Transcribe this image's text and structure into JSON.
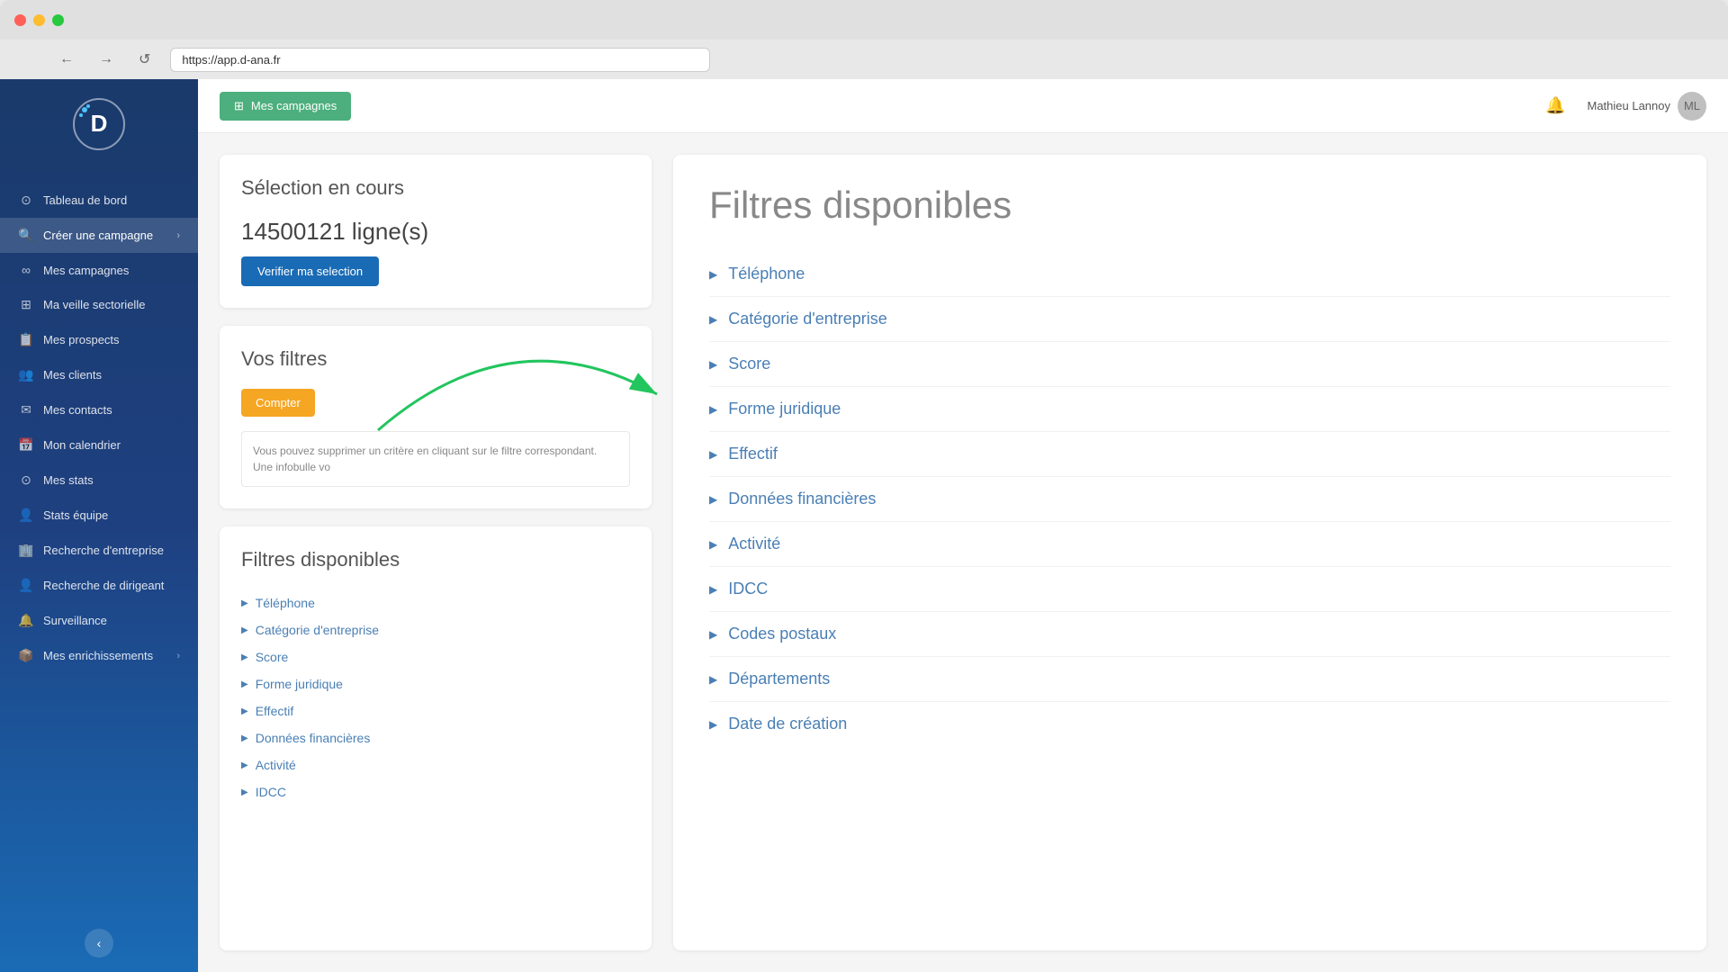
{
  "browser": {
    "url": "https://app.d-ana.fr",
    "traffic_lights": [
      "red",
      "yellow",
      "green"
    ]
  },
  "topbar": {
    "campagnes_label": "Mes campagnes",
    "user_name": "Mathieu Lannoy"
  },
  "sidebar": {
    "items": [
      {
        "id": "tableau-de-bord",
        "label": "Tableau de bord",
        "icon": "⊙"
      },
      {
        "id": "creer-campagne",
        "label": "Créer une campagne",
        "icon": "🔍",
        "active": true,
        "has_arrow": true
      },
      {
        "id": "mes-campagnes",
        "label": "Mes campagnes",
        "icon": "∞"
      },
      {
        "id": "ma-veille",
        "label": "Ma veille sectorielle",
        "icon": "⊞"
      },
      {
        "id": "mes-prospects",
        "label": "Mes prospects",
        "icon": "📋"
      },
      {
        "id": "mes-clients",
        "label": "Mes clients",
        "icon": "👥"
      },
      {
        "id": "mes-contacts",
        "label": "Mes contacts",
        "icon": "✉"
      },
      {
        "id": "mon-calendrier",
        "label": "Mon calendrier",
        "icon": "📅"
      },
      {
        "id": "mes-stats",
        "label": "Mes stats",
        "icon": "⊙"
      },
      {
        "id": "stats-equipe",
        "label": "Stats équipe",
        "icon": "👤"
      },
      {
        "id": "recherche-entreprise",
        "label": "Recherche d'entreprise",
        "icon": "🏢"
      },
      {
        "id": "recherche-dirigeant",
        "label": "Recherche de dirigeant",
        "icon": "👤"
      },
      {
        "id": "surveillance",
        "label": "Surveillance",
        "icon": "🔔"
      },
      {
        "id": "mes-enrichissements",
        "label": "Mes enrichissements",
        "icon": "📦",
        "has_arrow": true
      }
    ],
    "collapse_label": "‹"
  },
  "main": {
    "selection": {
      "title": "Sélection en cours",
      "count": "14500121 ligne(s)",
      "verify_btn": "Verifier ma selection"
    },
    "filtres": {
      "title": "Vos filtres",
      "compter_btn": "Compter",
      "hint": "Vous pouvez supprimer un critère en cliquant sur le filtre correspondant. Une infobulle vo"
    },
    "filtres_dispo_left": {
      "title": "Filtres disponibles",
      "items": [
        "Téléphone",
        "Catégorie d'entreprise",
        "Score",
        "Forme juridique",
        "Effectif",
        "Données financières",
        "Activité",
        "IDCC"
      ]
    },
    "filtres_dispo_right": {
      "title": "Filtres disponibles",
      "items": [
        "Téléphone",
        "Catégorie d'entreprise",
        "Score",
        "Forme juridique",
        "Effectif",
        "Données financières",
        "Activité",
        "IDCC",
        "Codes postaux",
        "Départements",
        "Date de création"
      ]
    }
  }
}
